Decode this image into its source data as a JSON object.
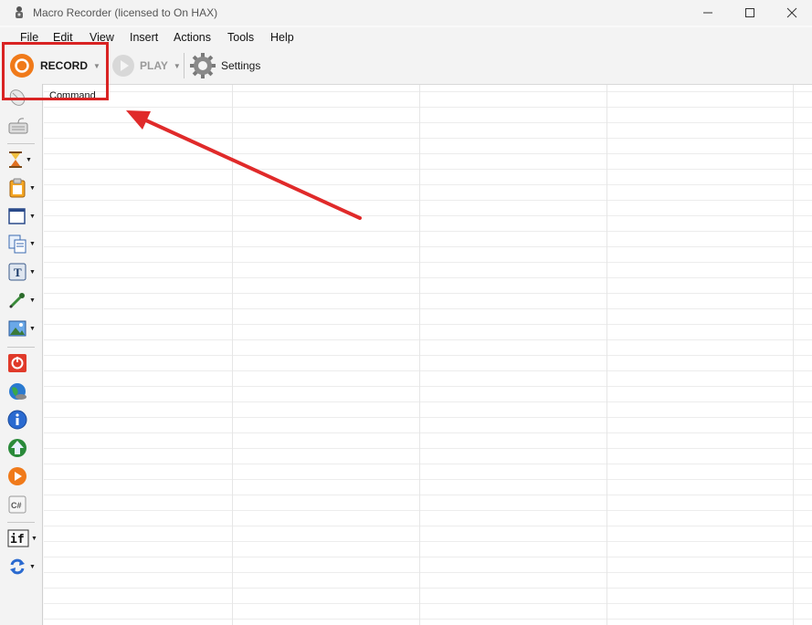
{
  "window": {
    "title": "Macro Recorder (licensed to On HAX)",
    "controls": {
      "minimize": "—",
      "maximize": "☐",
      "close": "✕"
    }
  },
  "menu": {
    "items": [
      "File",
      "Edit",
      "View",
      "Insert",
      "Actions",
      "Tools",
      "Help"
    ]
  },
  "toolbar": {
    "record_label": "RECORD",
    "play_label": "PLAY",
    "settings_label": "Settings"
  },
  "sidebar": {
    "items": [
      {
        "icon": "mouse-icon"
      },
      {
        "icon": "keyboard-icon"
      },
      {
        "icon": "hourglass-icon"
      },
      {
        "icon": "clipboard-icon"
      },
      {
        "icon": "window-icon"
      },
      {
        "icon": "copy-icon"
      },
      {
        "icon": "text-icon"
      },
      {
        "icon": "eyedropper-icon"
      },
      {
        "icon": "image-icon"
      },
      {
        "icon": "stop-icon"
      },
      {
        "icon": "globe-icon"
      },
      {
        "icon": "info-icon"
      },
      {
        "icon": "upload-icon"
      },
      {
        "icon": "play-icon"
      },
      {
        "icon": "csharp-icon",
        "text": "C#"
      },
      {
        "icon": "if-icon",
        "text": "if"
      },
      {
        "icon": "loop-icon"
      }
    ]
  },
  "grid": {
    "header": "Command"
  },
  "colors": {
    "highlight": "#d92323",
    "record_accent": "#f07a1a"
  }
}
